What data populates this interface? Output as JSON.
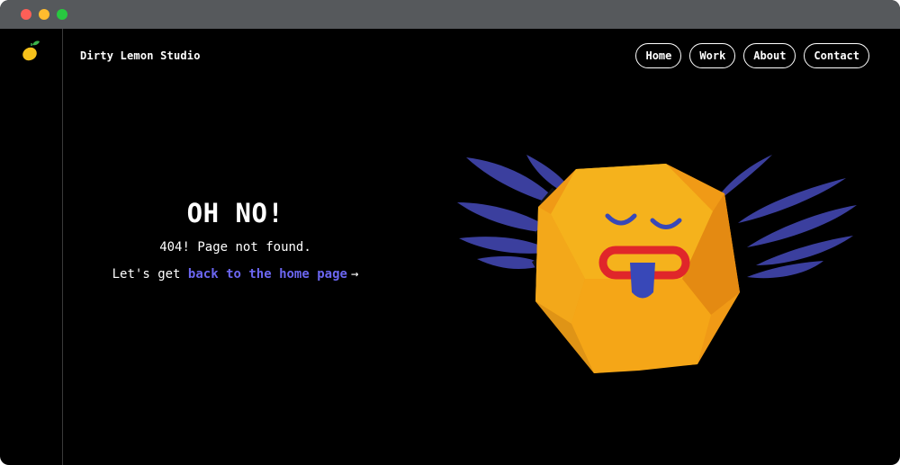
{
  "brand": {
    "name": "Dirty Lemon Studio",
    "logo_icon": "lemon-icon"
  },
  "nav": {
    "items": [
      {
        "label": "Home"
      },
      {
        "label": "Work"
      },
      {
        "label": "About"
      },
      {
        "label": "Contact"
      }
    ]
  },
  "error": {
    "title": "OH NO!",
    "subtitle": "404! Page not found.",
    "cta_prefix": "Let's get ",
    "cta_link": "back to the home page",
    "cta_arrow": "→"
  },
  "illustration": {
    "icon": "paper-dodecahedron-mascot-icon"
  },
  "colors": {
    "background": "#000000",
    "text": "#ffffff",
    "link": "#6b66f0",
    "mascot_yellow": "#f5b21c",
    "mascot_orange": "#f09a16",
    "feather_blue": "#3b3f9e",
    "mouth_red": "#e0262a",
    "tongue_blue": "#3848b8"
  }
}
